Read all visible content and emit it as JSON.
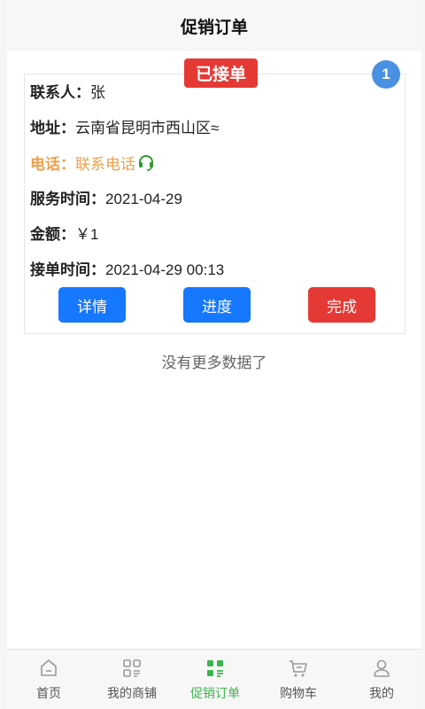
{
  "header": {
    "title": "促销订单"
  },
  "order": {
    "status": "已接单",
    "index": "1",
    "contact_label": "联系人：",
    "contact_value": "张",
    "address_label": "地址：",
    "address_value": "云南省昆明市西山区≈",
    "phone_label": "电话：",
    "phone_value": "联系电话",
    "service_time_label": "服务时间：",
    "service_time_value": "2021-04-29",
    "amount_label": "金额：",
    "amount_value": "￥1",
    "accept_time_label": "接单时间：",
    "accept_time_value": "2021-04-29 00:13",
    "buttons": {
      "detail": "详情",
      "progress": "进度",
      "done": "完成"
    }
  },
  "list": {
    "no_more": "没有更多数据了"
  },
  "tabbar": {
    "items": [
      {
        "label": "首页",
        "icon": "home-icon"
      },
      {
        "label": "我的商铺",
        "icon": "shop-icon"
      },
      {
        "label": "促销订单",
        "icon": "orders-icon"
      },
      {
        "label": "购物车",
        "icon": "cart-icon"
      },
      {
        "label": "我的",
        "icon": "user-icon"
      }
    ],
    "active_index": 2
  },
  "colors": {
    "accent_blue": "#1677ff",
    "danger_red": "#e53935",
    "active_green": "#3ab54a",
    "phone_orange": "#f0a04b"
  }
}
